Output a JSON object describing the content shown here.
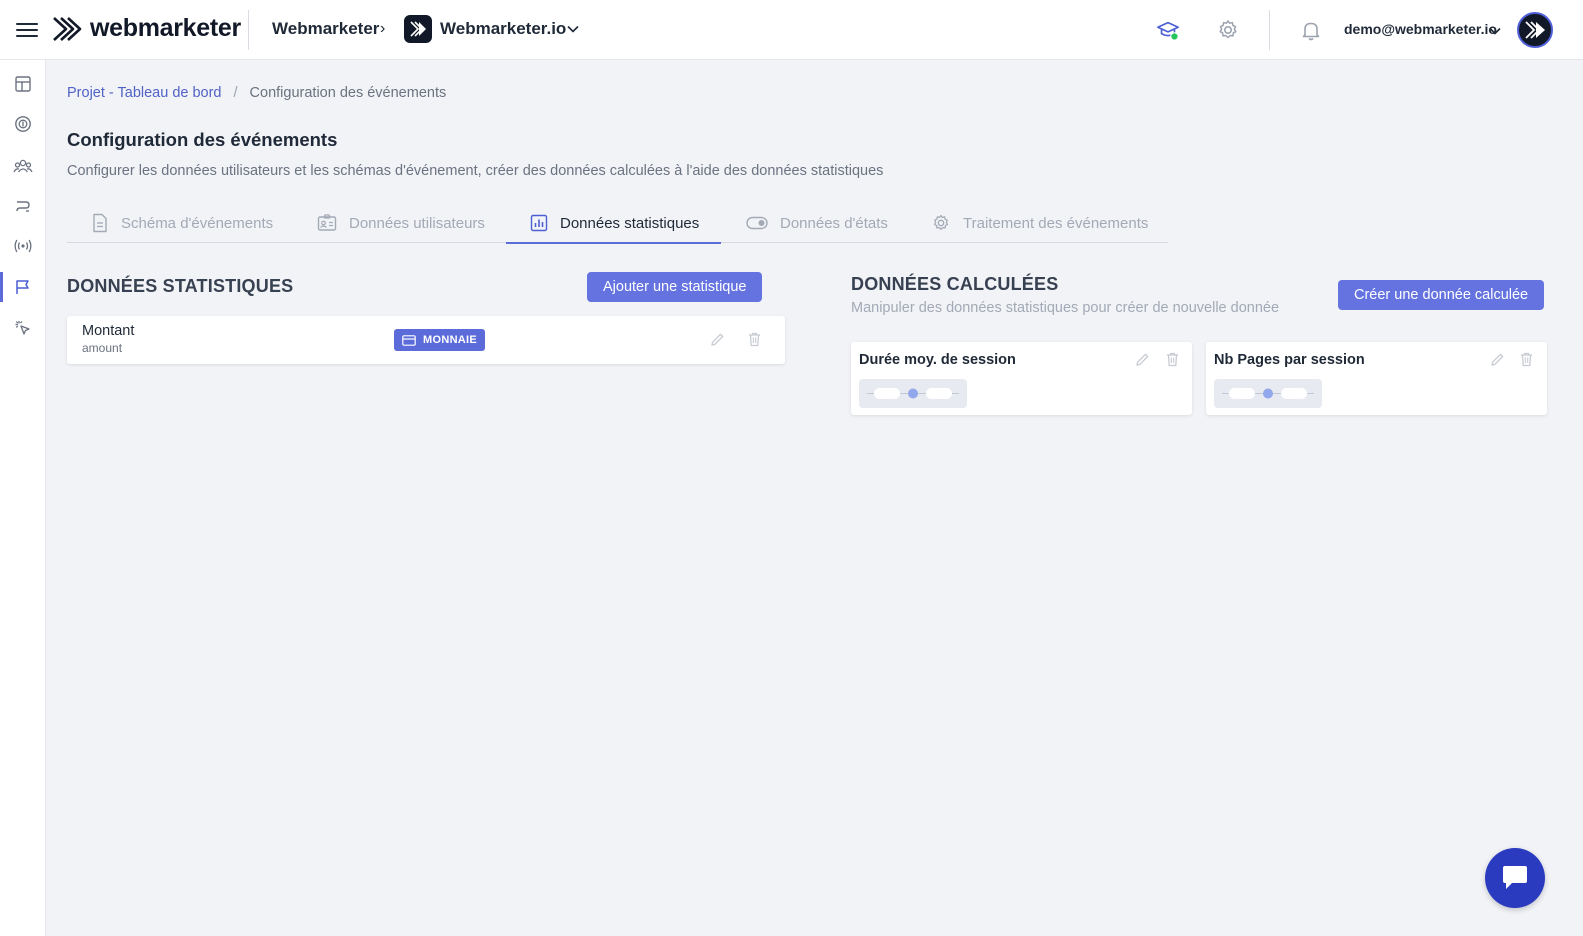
{
  "app": {
    "brand": "webmarketer",
    "organization": "Webmarketer",
    "project": "Webmarketer.io",
    "user_email": "demo@webmarketer.io"
  },
  "icons": {
    "menu": "hamburger-icon",
    "training": "graduation-cap-icon",
    "settings": "gear-icon",
    "notifications": "bell-icon",
    "chat": "chat-bubble-icon"
  },
  "sidebar": {
    "items": [
      {
        "icon": "dashboard-icon",
        "active": false
      },
      {
        "icon": "money-icon",
        "active": false
      },
      {
        "icon": "audience-icon",
        "active": false
      },
      {
        "icon": "flow-icon",
        "active": false
      },
      {
        "icon": "broadcast-icon",
        "active": false
      },
      {
        "icon": "flag-icon",
        "active": true
      },
      {
        "icon": "click-icon",
        "active": false
      }
    ]
  },
  "breadcrumb": {
    "parent": "Projet - Tableau de bord",
    "separator": "/",
    "current": "Configuration des événements"
  },
  "page": {
    "title": "Configuration des événements",
    "subtitle": "Configurer les données utilisateurs et les schémas d'événement, créer des données calculées à l'aide des données statistiques"
  },
  "tabs": [
    {
      "label": "Schéma d'événements",
      "active": false
    },
    {
      "label": "Données utilisateurs",
      "active": false
    },
    {
      "label": "Données statistiques",
      "active": true
    },
    {
      "label": "Données d'états",
      "active": false
    },
    {
      "label": "Traitement des événements",
      "active": false
    }
  ],
  "stats": {
    "title": "DONNÉES STATISTIQUES",
    "add_button": "Ajouter une statistique",
    "items": [
      {
        "name": "Montant",
        "key": "amount",
        "type_badge": "MONNAIE"
      }
    ]
  },
  "computed": {
    "title": "DONNÉES CALCULÉES",
    "subtitle": "Manipuler des données statistiques pour créer de nouvelle donnée",
    "create_button": "Créer une donnée calculée",
    "items": [
      {
        "name": "Durée moy. de session"
      },
      {
        "name": "Nb Pages par session"
      }
    ]
  },
  "colors": {
    "accent": "#6473e0",
    "active_tab": "#5b6bd9",
    "link": "#5162c6",
    "chat": "#2a3bc0",
    "background": "#f1f3f7"
  }
}
